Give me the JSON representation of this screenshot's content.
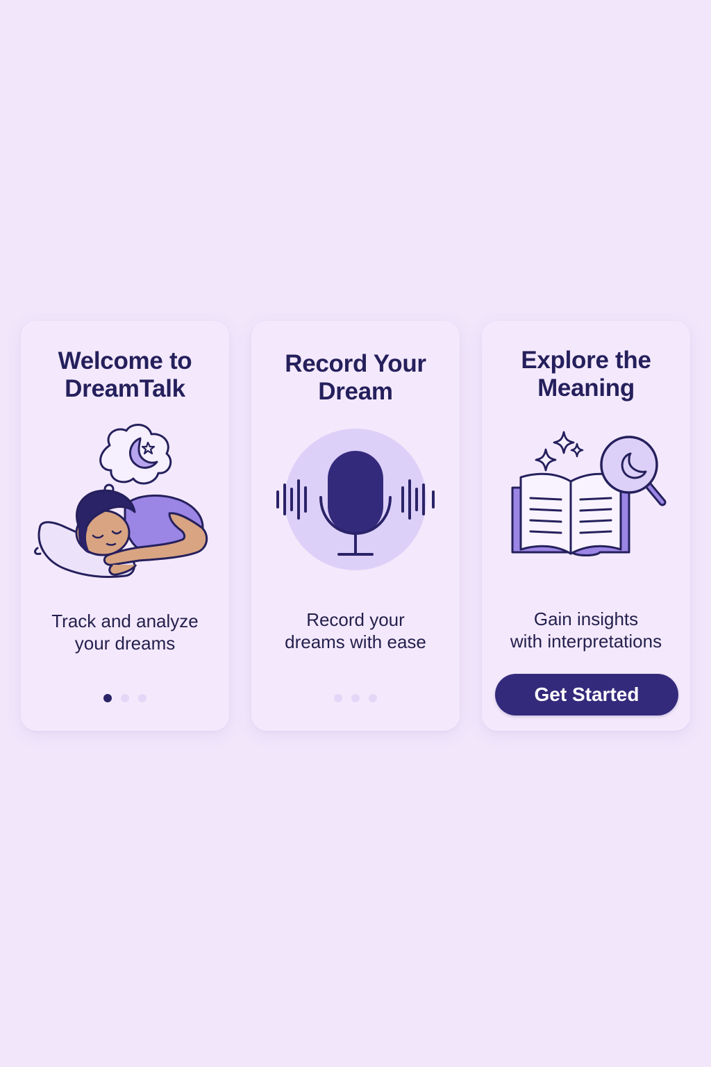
{
  "colors": {
    "page_background": "#f2e6fb",
    "card_background": "#f4e9fc",
    "heading": "#25205c",
    "accent_dark": "#342a7c",
    "accent_light": "#9b85e5",
    "accent_pale": "#ddd0f8",
    "dot_inactive": "#e4d6f7"
  },
  "screens": [
    {
      "title_line1": "Welcome to",
      "title_line2": "DreamTalk",
      "illustration": "sleeping-person-with-dream-bubble",
      "description_line1": "Track and analyze",
      "description_line2": "your dreams",
      "page_indicator": {
        "count": 3,
        "active": 1
      }
    },
    {
      "title_line1": "Record Your",
      "title_line2": "Dream",
      "illustration": "microphone-with-sound-waves",
      "description_line1": "Record your",
      "description_line2": "dreams with ease",
      "page_indicator": {
        "count": 3,
        "active": null
      }
    },
    {
      "title_line1": "Explore the",
      "title_line2": "Meaning",
      "illustration": "open-book-with-magnifier-moon-and-sparkles",
      "description_line1": "Gain insights",
      "description_line2": "with interpretations",
      "cta_label": "Get Started"
    }
  ]
}
